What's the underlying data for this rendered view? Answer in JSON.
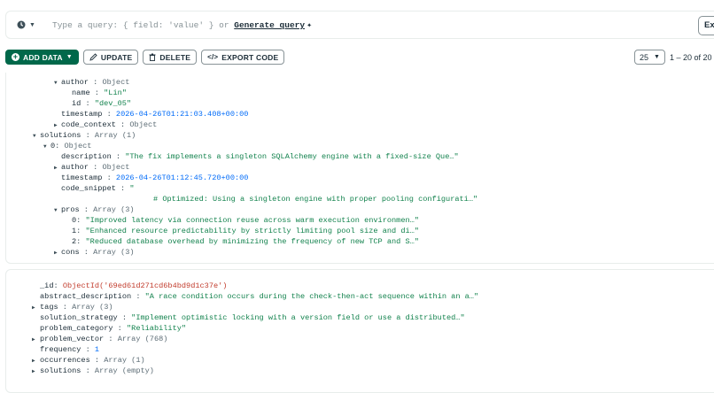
{
  "querybar": {
    "placeholder": "Type a query: { field: 'value' } or",
    "generate_label": "Generate query",
    "explain_label": "Ex"
  },
  "toolbar": {
    "add_data": "ADD DATA",
    "update": "UPDATE",
    "delete": "DELETE",
    "export_code": "EXPORT CODE"
  },
  "pagination": {
    "page_size": "25",
    "range": "1 – 20 of 20"
  },
  "doc1": {
    "author_key": "author",
    "author_type": "Object",
    "name_key": "name",
    "name_val": "\"Lin\"",
    "id_key": "id",
    "id_val": "\"dev_05\"",
    "timestamp_key": "timestamp",
    "timestamp_val": "2026-04-26T01:21:03.408+00:00",
    "code_context_key": "code_context",
    "code_context_type": "Object",
    "solutions_key": "solutions",
    "solutions_type": "Array (1)",
    "item0_key": "0",
    "item0_type": "Object",
    "description_key": "description",
    "description_val": "\"The fix implements a singleton SQLAlchemy engine with a fixed-size Que…\"",
    "author2_key": "author",
    "author2_type": "Object",
    "timestamp2_key": "timestamp",
    "timestamp2_val": "2026-04-26T01:12:45.720+00:00",
    "code_snippet_key": "code_snippet",
    "code_snippet_val": "\"",
    "code_snippet_cont": "# Optimized: Using a singleton engine with proper pooling configurati…\"",
    "pros_key": "pros",
    "pros_type": "Array (3)",
    "pros": [
      {
        "key": "0",
        "val": "\"Improved latency via connection reuse across warm execution environmen…\""
      },
      {
        "key": "1",
        "val": "\"Enhanced resource predictability by strictly limiting pool size and di…\""
      },
      {
        "key": "2",
        "val": "\"Reduced database overhead by minimizing the frequency of new TCP and S…\""
      }
    ],
    "cons_key": "cons",
    "cons_type": "Array (3)"
  },
  "doc2": {
    "id_key": "_id",
    "id_val": "ObjectId('69ed61d271cd6b4bd9d1c37e')",
    "abstract_key": "abstract_description",
    "abstract_val": "\"A race condition occurs during the check-then-act sequence within an a…\"",
    "tags_key": "tags",
    "tags_type": "Array (3)",
    "strategy_key": "solution_strategy",
    "strategy_val": "\"Implement optimistic locking with a version field or use a distributed…\"",
    "category_key": "problem_category",
    "category_val": "\"Reliability\"",
    "vector_key": "problem_vector",
    "vector_type": "Array (768)",
    "frequency_key": "frequency",
    "frequency_val": "1",
    "occurrences_key": "occurrences",
    "occurrences_type": "Array (1)",
    "solutions_key": "solutions",
    "solutions_type": "Array (empty)"
  }
}
